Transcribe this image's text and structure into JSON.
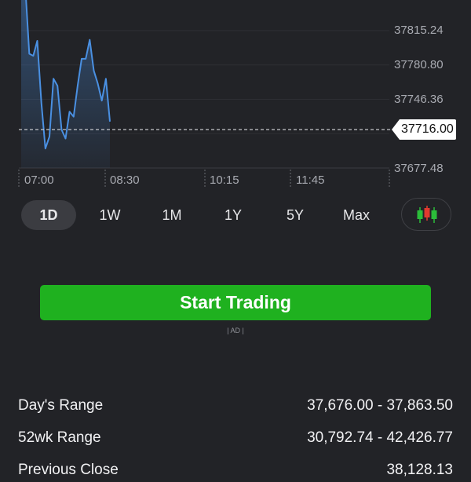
{
  "chart": {
    "y_labels": [
      "37815.24",
      "37780.80",
      "37746.36",
      "37677.48"
    ],
    "last_price": "37716.00",
    "x_labels": [
      "07:00",
      "08:30",
      "10:15",
      "11:45"
    ],
    "line_color": "#4a90e2",
    "series": [
      37873,
      37861,
      37792,
      37790,
      37805,
      37743,
      37697,
      37709,
      37767,
      37760,
      37716,
      37707,
      37734,
      37729,
      37760,
      37787,
      37787,
      37806,
      37775,
      37762,
      37745,
      37767,
      37724
    ]
  },
  "ranges": [
    {
      "label": "1D",
      "active": true
    },
    {
      "label": "1W",
      "active": false
    },
    {
      "label": "1M",
      "active": false
    },
    {
      "label": "1Y",
      "active": false
    },
    {
      "label": "5Y",
      "active": false
    },
    {
      "label": "Max",
      "active": false
    }
  ],
  "candle_icon": "candlestick-chart-icon",
  "cta": {
    "label": "Start Trading",
    "color": "#1fb11f"
  },
  "ad_label": "| AD |",
  "stats": [
    {
      "label": "Day's Range",
      "value": "37,676.00 - 37,863.50"
    },
    {
      "label": "52wk Range",
      "value": "30,792.74 - 42,426.77"
    },
    {
      "label": "Previous Close",
      "value": "38,128.13"
    }
  ]
}
